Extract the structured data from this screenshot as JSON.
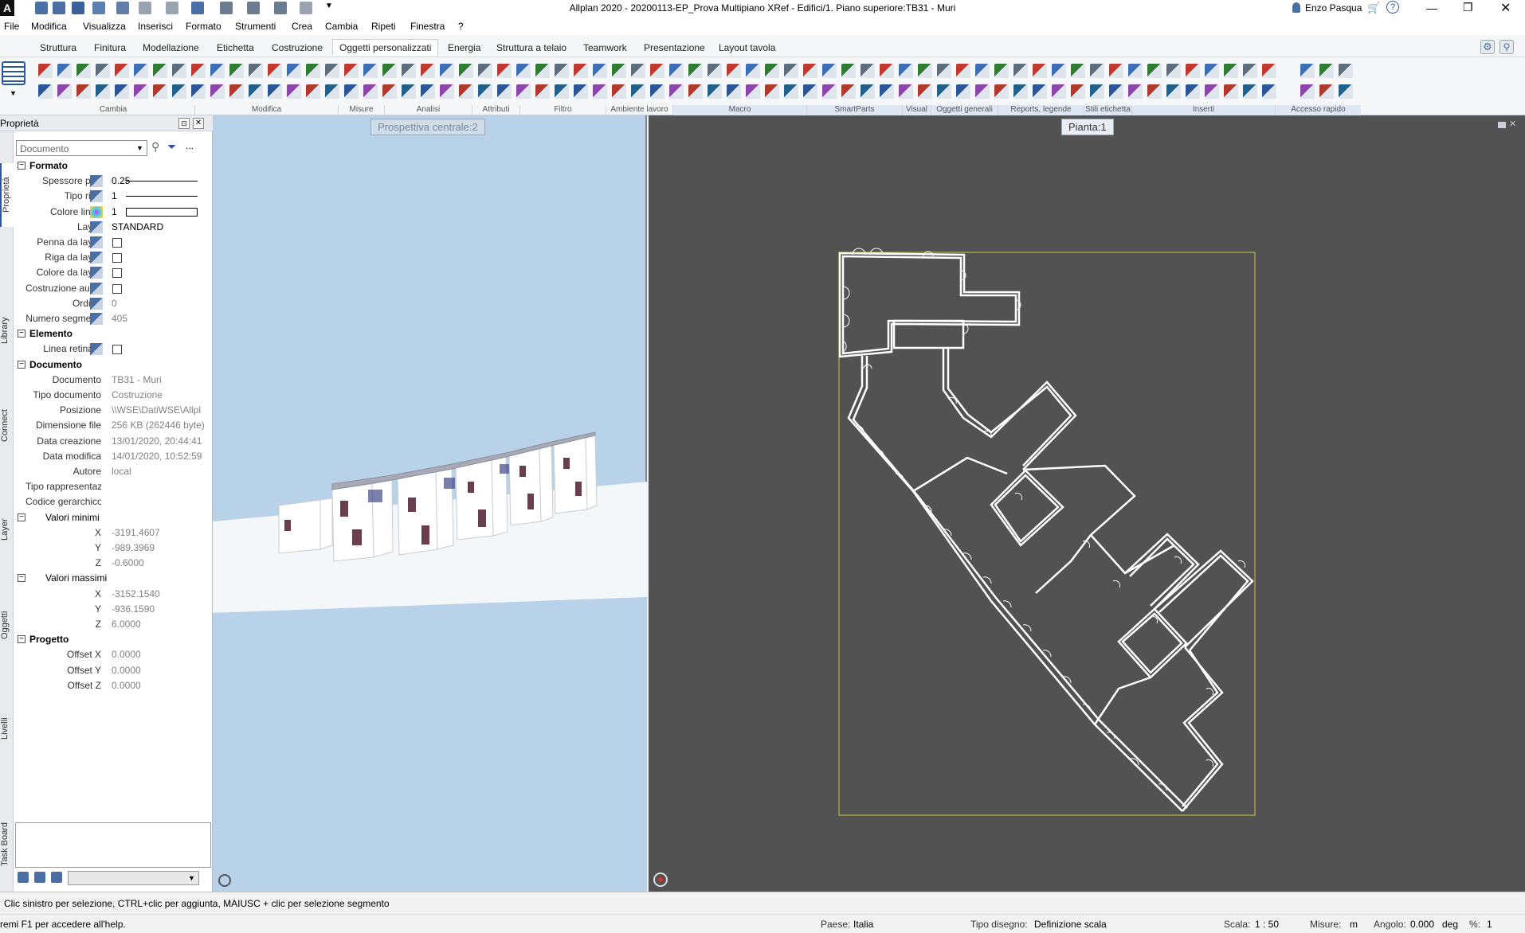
{
  "window": {
    "title": "Allplan 2020 - 20200113-EP_Prova Multipiano XRef - Edifici/1. Piano superiore:TB31 - Muri",
    "user": "Enzo Pasqua",
    "help_label": "?"
  },
  "menu": [
    "File",
    "Modifica",
    "Visualizza",
    "Inserisci",
    "Formato",
    "Strumenti",
    "Crea",
    "Cambia",
    "Ripeti",
    "Finestra",
    "?"
  ],
  "tabs": [
    "Struttura",
    "Finitura",
    "Modellazione",
    "Etichetta",
    "Costruzione",
    "Oggetti personalizzati",
    "Energia",
    "Struttura a telaio",
    "Teamwork",
    "Presentazione",
    "Layout tavola"
  ],
  "active_tab": "Oggetti personalizzati",
  "ribbon_groups": [
    "Cambia",
    "Modifica",
    "Misure",
    "Analisi",
    "Attributi",
    "Filtro",
    "Ambiente lavoro",
    "Macro",
    "SmartParts",
    "Visual ...",
    "Oggetti generali",
    "Reports, legende",
    "Stili etichetta",
    "Inserti",
    "Accesso rapido"
  ],
  "side_tabs": [
    "Proprietà",
    "Library",
    "Connect",
    "Layer",
    "Oggetti",
    "Livelli",
    "Task Board"
  ],
  "properties": {
    "header": "Proprietà",
    "selector": "Documento",
    "more": "...",
    "sections": {
      "formato": "Formato",
      "elemento": "Elemento",
      "documento": "Documento",
      "valori_minimi": "Valori minimi",
      "valori_massimi": "Valori massimi",
      "progetto": "Progetto"
    },
    "formato_rows": [
      {
        "label": "Spessore pen",
        "value": "0.25"
      },
      {
        "label": "Tipo riga",
        "value": "1"
      },
      {
        "label": "Colore linea",
        "value": "1"
      },
      {
        "label": "Layer",
        "value": "STANDARD"
      },
      {
        "label": "Penna da layer",
        "value": ""
      },
      {
        "label": "Riga da layer",
        "value": ""
      },
      {
        "label": "Colore da layer",
        "value": ""
      },
      {
        "label": "Costruzione ausiliaria",
        "value": ""
      },
      {
        "label": "Ordine",
        "value": "0"
      },
      {
        "label": "Numero segmenti",
        "value": "405"
      }
    ],
    "elemento_rows": [
      {
        "label": "Linea retinata",
        "value": ""
      }
    ],
    "documento_rows": [
      {
        "label": "Documento",
        "value": "TB31 - Muri"
      },
      {
        "label": "Tipo documento",
        "value": "Costruzione"
      },
      {
        "label": "Posizione",
        "value": "\\\\WSE\\DatiWSE\\Allpl"
      },
      {
        "label": "Dimensione file",
        "value": "256 KB (262446 byte)"
      },
      {
        "label": "Data creazione",
        "value": "13/01/2020, 20:44:41"
      },
      {
        "label": "Data modifica",
        "value": "14/01/2020, 10:52:59"
      },
      {
        "label": "Autore",
        "value": "local"
      },
      {
        "label": "Tipo rappresentazione",
        "value": ""
      },
      {
        "label": "Codice gerarchico",
        "value": ""
      }
    ],
    "min": [
      {
        "label": "X",
        "value": "-3191.4607"
      },
      {
        "label": "Y",
        "value": "-989.3969"
      },
      {
        "label": "Z",
        "value": "-0.6000"
      }
    ],
    "max": [
      {
        "label": "X",
        "value": "-3152.1540"
      },
      {
        "label": "Y",
        "value": "-936.1590"
      },
      {
        "label": "Z",
        "value": "6.0000"
      }
    ],
    "progetto_rows": [
      {
        "label": "Offset X",
        "value": "0.0000"
      },
      {
        "label": "Offset Y",
        "value": "0.0000"
      },
      {
        "label": "Offset Z",
        "value": "0.0000"
      }
    ]
  },
  "viewports": {
    "left_label": "Prospettiva centrale:2",
    "right_label": "Pianta:1"
  },
  "status": {
    "hint": "Clic sinistro per selezione, CTRL+clic per aggiunta, MAIUSC + clic per selezione segmento",
    "help": "remi F1 per accedere all'help.",
    "country_label": "Paese:",
    "country": "Italia",
    "drawing_type_label": "Tipo disegno:",
    "drawing_type": "Definizione scala",
    "scale_label": "Scala:",
    "scale": "1 : 50",
    "units_label": "Misure:",
    "units": "m",
    "angle_label": "Angolo:",
    "angle": "0.000",
    "angle_unit": "deg",
    "percent_label": "%:",
    "percent": "1"
  },
  "colors": {
    "viewport_3d_bg": "#b8d2ea",
    "viewport_plan_bg": "#525252",
    "plan_border": "#c8c83c",
    "accent": "#2b579a"
  }
}
